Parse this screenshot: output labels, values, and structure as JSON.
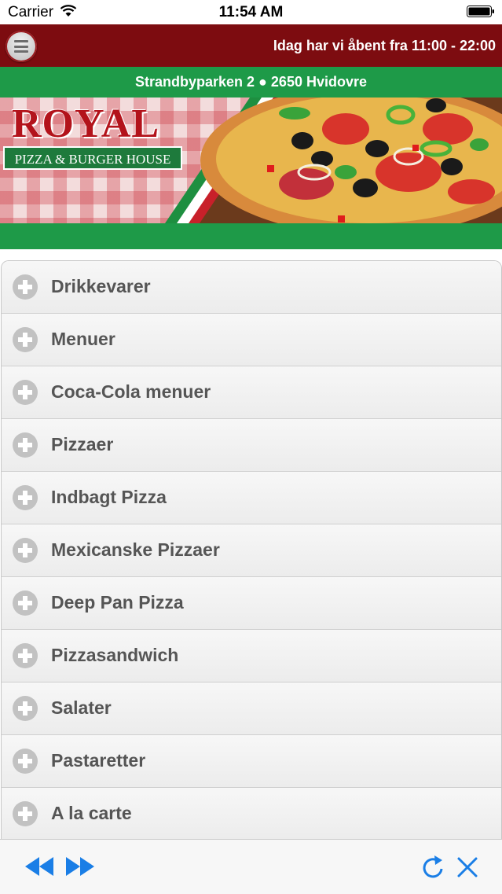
{
  "status_bar": {
    "carrier": "Carrier",
    "time": "11:54 AM",
    "icons": [
      "wifi-icon",
      "battery-icon"
    ]
  },
  "header": {
    "menu_icon": "hamburger-menu-icon",
    "opening_hours": "Idag har vi åbent fra 11:00 - 22:00"
  },
  "address": "Strandbyparken 2 ● 2650 Hvidovre",
  "banner": {
    "logo_title": "ROYAL",
    "logo_subtitle": "PIZZA & BURGER HOUSE"
  },
  "categories": [
    {
      "label": "Drikkevarer",
      "icon": "plus-icon"
    },
    {
      "label": "Menuer",
      "icon": "plus-icon"
    },
    {
      "label": "Coca-Cola menuer",
      "icon": "plus-icon"
    },
    {
      "label": "Pizzaer",
      "icon": "plus-icon"
    },
    {
      "label": "Indbagt Pizza",
      "icon": "plus-icon"
    },
    {
      "label": "Mexicanske Pizzaer",
      "icon": "plus-icon"
    },
    {
      "label": "Deep Pan Pizza",
      "icon": "plus-icon"
    },
    {
      "label": "Pizzasandwich",
      "icon": "plus-icon"
    },
    {
      "label": "Salater",
      "icon": "plus-icon"
    },
    {
      "label": "Pastaretter",
      "icon": "plus-icon"
    },
    {
      "label": "A la carte",
      "icon": "plus-icon"
    }
  ],
  "toolbar": {
    "icons": [
      "back-icon",
      "forward-icon",
      "refresh-icon",
      "close-icon"
    ]
  },
  "colors": {
    "header_bg": "#7d0c10",
    "green": "#1e9a48",
    "accent_blue": "#1a7ee6",
    "item_text": "#555555"
  }
}
